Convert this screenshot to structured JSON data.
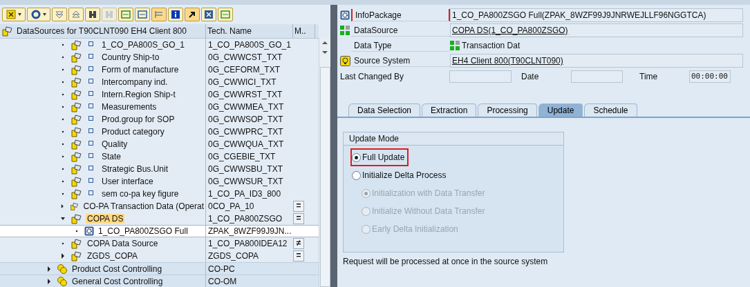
{
  "toolbar": [
    {
      "kind": "select",
      "menu": true,
      "pressed": false,
      "disabled": false
    },
    {
      "kind": "refresh",
      "menu": true,
      "pressed": false,
      "disabled": false
    },
    {
      "kind": "expand",
      "menu": false,
      "pressed": false,
      "disabled": false
    },
    {
      "kind": "collapse",
      "menu": false,
      "pressed": false,
      "disabled": false
    },
    {
      "kind": "find",
      "menu": false,
      "pressed": false,
      "disabled": false
    },
    {
      "kind": "find_next",
      "menu": false,
      "pressed": false,
      "disabled": true
    },
    {
      "kind": "create",
      "menu": false,
      "pressed": false,
      "disabled": false
    },
    {
      "kind": "display",
      "menu": false,
      "pressed": false,
      "disabled": false
    },
    {
      "kind": "columns",
      "menu": false,
      "pressed": true,
      "disabled": false
    },
    {
      "kind": "info",
      "menu": false,
      "pressed": false,
      "disabled": false
    },
    {
      "kind": "jump",
      "menu": false,
      "pressed": true,
      "disabled": false
    },
    {
      "kind": "cancel",
      "menu": false,
      "pressed": false,
      "disabled": false
    },
    {
      "kind": "transfer",
      "menu": false,
      "pressed": false,
      "disabled": false
    }
  ],
  "tree": {
    "columns": [
      "DataSources for T90CLNT090 EH4 Client 800",
      "Tech. Name",
      "M.."
    ],
    "rows": [
      {
        "kind": "text_source",
        "label": "1_CO_PA800S_GO_1",
        "tech": "1_CO_PA800S_GO_1",
        "selected": false,
        "highlighted": false
      },
      {
        "kind": "text_source",
        "label": "Country Ship-to",
        "tech": "0G_CWWCST_TXT",
        "selected": false,
        "highlighted": false
      },
      {
        "kind": "text_source",
        "label": "Form of manufacture",
        "tech": "0G_CEFORM_TXT",
        "selected": false,
        "highlighted": false
      },
      {
        "kind": "text_source",
        "label": "Intercompany ind.",
        "tech": "0G_CWWICI_TXT",
        "selected": false,
        "highlighted": false
      },
      {
        "kind": "text_source",
        "label": "Intern.Region Ship-t",
        "tech": "0G_CWWRST_TXT",
        "selected": false,
        "highlighted": false
      },
      {
        "kind": "text_source",
        "label": "Measurements",
        "tech": "0G_CWWMEA_TXT",
        "selected": false,
        "highlighted": false
      },
      {
        "kind": "text_source",
        "label": "Prod.group for SOP",
        "tech": "0G_CWWSOP_TXT",
        "selected": false,
        "highlighted": false
      },
      {
        "kind": "text_source",
        "label": "Product category",
        "tech": "0G_CWWPRC_TXT",
        "selected": false,
        "highlighted": false
      },
      {
        "kind": "text_source",
        "label": "Quality",
        "tech": "0G_CWWQUA_TXT",
        "selected": false,
        "highlighted": false
      },
      {
        "kind": "text_source",
        "label": "State",
        "tech": "0G_CGEBIE_TXT",
        "selected": false,
        "highlighted": false
      },
      {
        "kind": "text_source",
        "label": "Strategic Bus.Unit",
        "tech": "0G_CWWSBU_TXT",
        "selected": false,
        "highlighted": false
      },
      {
        "kind": "text_source",
        "label": "User interface",
        "tech": "0G_CWWSUR_TXT",
        "selected": false,
        "highlighted": false
      },
      {
        "kind": "text_source",
        "label": "sem co-pa key figure",
        "tech": "1_CO_PA_ID3_800",
        "selected": false,
        "highlighted": false
      },
      {
        "kind": "source",
        "label": "CO-PA Transaction Data (Operat",
        "tech": "0CO_PA_10",
        "compare": "=",
        "expanded": false,
        "selected": false,
        "highlighted": false
      },
      {
        "kind": "source",
        "label": "COPA DS",
        "tech": "1_CO_PA800ZSGO",
        "compare": "=",
        "expanded": true,
        "selected": false,
        "highlighted": true,
        "children": [
          {
            "kind": "infopackage",
            "label": "1_CO_PA800ZSGO Full",
            "tech": "ZPAK_8WZF99J9JN...",
            "selected": true,
            "highlighted": false
          }
        ]
      },
      {
        "kind": "source",
        "label": "COPA Data Source",
        "tech": "1_CO_PA800IDEA12",
        "compare": "≠",
        "selected": false,
        "highlighted": false
      },
      {
        "kind": "source",
        "label": "ZGDS_COPA",
        "tech": "ZGDS_COPA",
        "compare": "=",
        "expanded": false,
        "selected": false,
        "highlighted": false
      },
      {
        "kind": "component",
        "label": "Product Cost Controlling",
        "tech": "CO-PC",
        "expanded": false,
        "selected": false,
        "highlighted": false
      },
      {
        "kind": "component",
        "label": "General Cost Controlling",
        "tech": "CO-OM",
        "expanded": false,
        "selected": false,
        "highlighted": false
      }
    ]
  },
  "header": [
    {
      "kind": "infopackage",
      "label": "InfoPackage",
      "value": "1_CO_PA800ZSGO Full(ZPAK_8WZF99J9JNRWEJLLF96NGGTCA)",
      "focused": true
    },
    {
      "kind": "datasource",
      "label": "DataSource",
      "value": "COPA DS(1_CO_PA800ZSGO)",
      "focused": false
    },
    {
      "kind": "datatype",
      "label": "Data Type",
      "value": "Transaction Dat",
      "focused": false
    },
    {
      "kind": "system",
      "label": "Source System",
      "value": "EH4 Client 800(T90CLNT090)",
      "focused": false
    }
  ],
  "changed": {
    "by_label": "Last Changed By",
    "date_label": "Date",
    "time_label": "Time",
    "time": "00:00:00"
  },
  "tabs": [
    {
      "label": "Data Selection",
      "selected": false
    },
    {
      "label": "Extraction",
      "selected": false
    },
    {
      "label": "Processing",
      "selected": false
    },
    {
      "label": "Update",
      "selected": true
    },
    {
      "label": "Schedule",
      "selected": false
    }
  ],
  "update_mode": {
    "title": "Update Mode",
    "options": [
      {
        "label": "Full Update",
        "selected": true,
        "disabled": false,
        "highlighted": true
      },
      {
        "label": "Initialize Delta Process",
        "selected": false,
        "disabled": false,
        "highlighted": false,
        "children": [
          {
            "label": "Initialization with Data Transfer",
            "selected": true,
            "disabled": true
          },
          {
            "label": "Initialize Without Data Transfer",
            "selected": false,
            "disabled": true
          },
          {
            "label": "Early Delta Initialization",
            "selected": false,
            "disabled": true
          }
        ]
      }
    ]
  },
  "message": "Request will be processed at once in the source system"
}
